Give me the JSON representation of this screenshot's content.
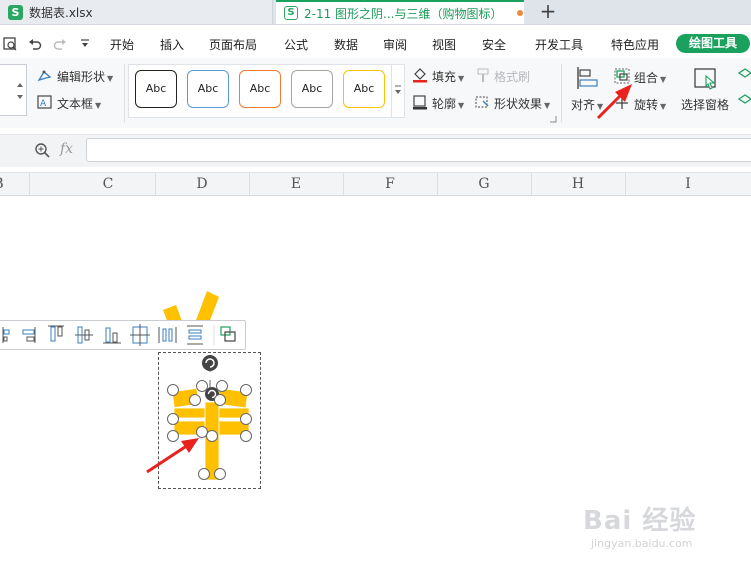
{
  "tabs": [
    {
      "icon": "S",
      "title": "数据表.xlsx",
      "active": false
    },
    {
      "icon": "S",
      "title": "2-11 图形之阴...与三维（购物图标）",
      "active": true
    }
  ],
  "new_tab_label": "+",
  "menu": {
    "items": [
      "开始",
      "插入",
      "页面布局",
      "公式",
      "数据",
      "审阅",
      "视图",
      "安全",
      "开发工具",
      "特色应用"
    ],
    "active": "绘图工具"
  },
  "ribbon": {
    "edit_shape": "编辑形状",
    "text_box": "文本框",
    "style_samples": [
      "Abc",
      "Abc",
      "Abc",
      "Abc",
      "Abc"
    ],
    "style_colors": [
      "#222222",
      "#5b9bd5",
      "#ed7d31",
      "#a5a5a5",
      "#ffc000"
    ],
    "fill": "填充",
    "format_painter": "格式刷",
    "outline": "轮廓",
    "shape_effects": "形状效果",
    "align": "对齐",
    "group": "组合",
    "rotate": "旋转",
    "selection_pane": "选择窗格"
  },
  "formula": {
    "fx_label": "fx",
    "value": ""
  },
  "columns": [
    "B",
    "C",
    "D",
    "E",
    "F",
    "G",
    "H",
    "I"
  ],
  "shape_color": "#ffc000",
  "accent_color": "#1aa15e",
  "annotation_color": "#e8231e",
  "watermark": {
    "brand": "Bai 经验",
    "url": "jingyan.baidu.com"
  }
}
